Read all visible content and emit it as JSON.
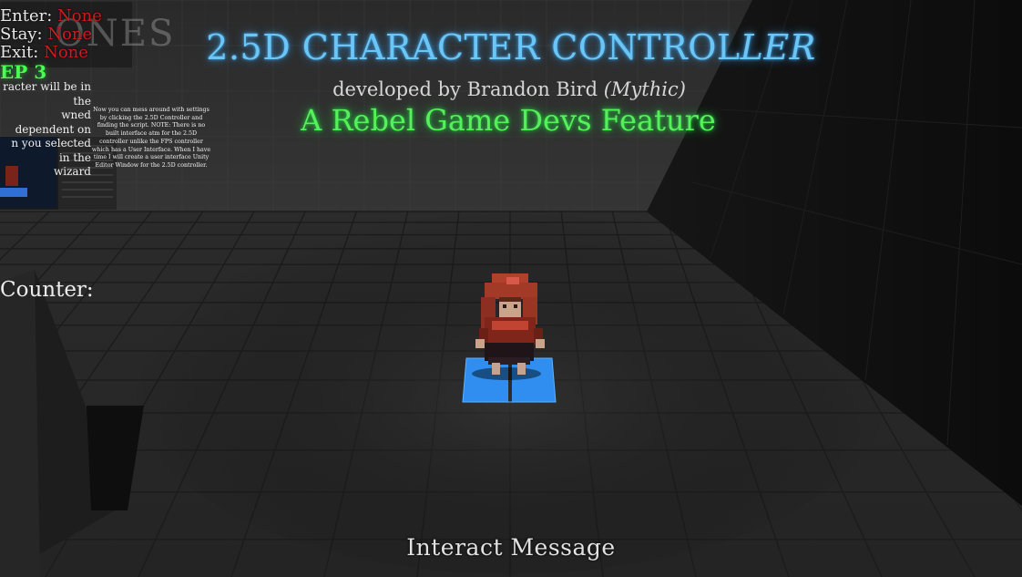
{
  "hud": {
    "enter_label": "Enter:",
    "enter_value": "None",
    "stay_label": "Stay:",
    "stay_value": "None",
    "exit_label": "Exit:",
    "exit_value": "None",
    "zones_watermark": "ONES",
    "counter_label": "Counter:",
    "interact_message": "Interact Message"
  },
  "titles": {
    "title_main": "2.5D CHARACTER CONTROL",
    "title_italic": "LER",
    "byline_prefix": "developed by Brandon Bird ",
    "byline_alias": "(Mythic)",
    "feature": "A Rebel Game Devs Feature"
  },
  "instructions": {
    "step_title": "EP 3",
    "step_body": "racter will be in the\nwned dependent on\nn you selected in the\nwizard",
    "note": "Now you can mess around with settings by clicking the 2.5D Controller and finding the script. NOTE: There is no built interface atm for the 2.5D controller unlike the FPS controller which has a User Interface. When I have time I will create a user interface Unity Editor Window for the 2.5D controller."
  },
  "colors": {
    "title_blue": "#69c6f7",
    "feature_green": "#56f05b",
    "step_green": "#48ff52",
    "trigger_red": "#cc1d1d",
    "player_tile_blue": "#2f8ef0"
  }
}
